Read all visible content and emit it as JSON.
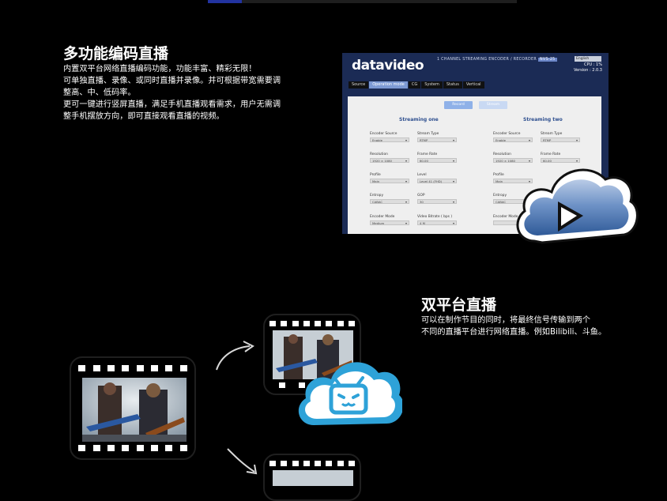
{
  "top_progress": {
    "fill_fraction": 0.11,
    "accent": "#2233a0"
  },
  "section1": {
    "title": "多功能编码直播",
    "lines": [
      "内置双平台网络直播编码功能，功能丰富、精彩无限！",
      "可单独直播、录像、或同时直播并录像。并可根据带宽需要调",
      "整高、中、低码率。",
      "更可一键进行竖屏直播，满足手机直播观看需求，用户无需调",
      "整手机摆放方向，即可直接观看直播的视频。"
    ]
  },
  "encoder_ui": {
    "logo": "datavideo",
    "subtitle": "1 CHANNEL STREAMING ENCODER / RECORDER",
    "model": "NVS-25",
    "language": "English",
    "cpu": "CPU : 1%",
    "version": "Version : 2.0.3",
    "tabs": [
      "Source",
      "Operation mode",
      "CG",
      "System",
      "Status",
      "Vertical"
    ],
    "active_tab": "Operation mode",
    "buttons": [
      "Record",
      "Stream"
    ],
    "columns": [
      {
        "title": "Streaming one",
        "fields": [
          {
            "label": "Encoder Source",
            "value": "Enable"
          },
          {
            "label": "Stream Type",
            "value": "RTMP"
          },
          {
            "label": "Resolution",
            "value": "1920 × 1080"
          },
          {
            "label": "Frame Rate",
            "value": "60.00"
          },
          {
            "label": "Profile",
            "value": "Main"
          },
          {
            "label": "Level",
            "value": "Level 41 (FHD)"
          },
          {
            "label": "Entropy",
            "value": "CABAC"
          },
          {
            "label": "GOP",
            "value": "30"
          },
          {
            "label": "Encoder Mode",
            "value": "Medium"
          },
          {
            "label": "Video Bitrate ( bps )",
            "value": "4 M"
          }
        ]
      },
      {
        "title": "Streaming two",
        "fields": [
          {
            "label": "Encoder Source",
            "value": "Enable"
          },
          {
            "label": "Stream Type",
            "value": "RTMP"
          },
          {
            "label": "Resolution",
            "value": "1920 × 1080"
          },
          {
            "label": "Frame Rate",
            "value": "60.00"
          },
          {
            "label": "Profile",
            "value": "Main"
          },
          {
            "label": "Entropy",
            "value": "CABAC"
          },
          {
            "label": "Encoder Mode",
            "value": ""
          }
        ]
      }
    ]
  },
  "section2": {
    "title": "双平台直播",
    "lines": [
      "可以在制作节目的同时，将最终信号传输到两个",
      "不同的直播平台进行网络直播。例如Bilibili、斗鱼。"
    ]
  },
  "icons": {
    "play_cloud": "cloud-play-icon",
    "bilibili": "bilibili-tv-cloud-icon",
    "arrow": "curved-arrow-icon"
  }
}
